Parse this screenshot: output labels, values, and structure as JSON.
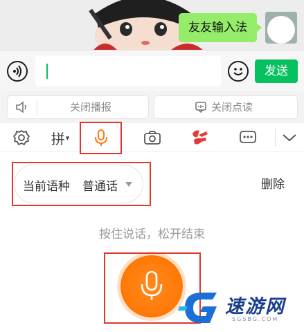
{
  "chat": {
    "message": "友友输入法"
  },
  "input_bar": {
    "value": "",
    "send_label": "发送"
  },
  "broadcast": {
    "close_broadcast": "关闭播报",
    "close_read": "关闭点读"
  },
  "toolbar": {
    "pinyin_label": "拼",
    "pinyin_arrow": "▾",
    "active": "voice",
    "icons": [
      "settings-icon",
      "pinyin",
      "microphone-icon",
      "camera-icon",
      "youliao-icon",
      "chat-bubble-icon",
      "chevron-down-icon"
    ]
  },
  "voice_panel": {
    "language_label": "当前语种",
    "language_value": "普通话",
    "delete_label": "删除",
    "hint": "按住说话，松开结束"
  },
  "watermark": {
    "brand": "速游网",
    "sub": "SGSBG.COM"
  },
  "colors": {
    "accent": "#07c160",
    "bubble": "#95ec69",
    "mic_orange": "#ff7b0a",
    "highlight_frame": "#e0362b"
  }
}
